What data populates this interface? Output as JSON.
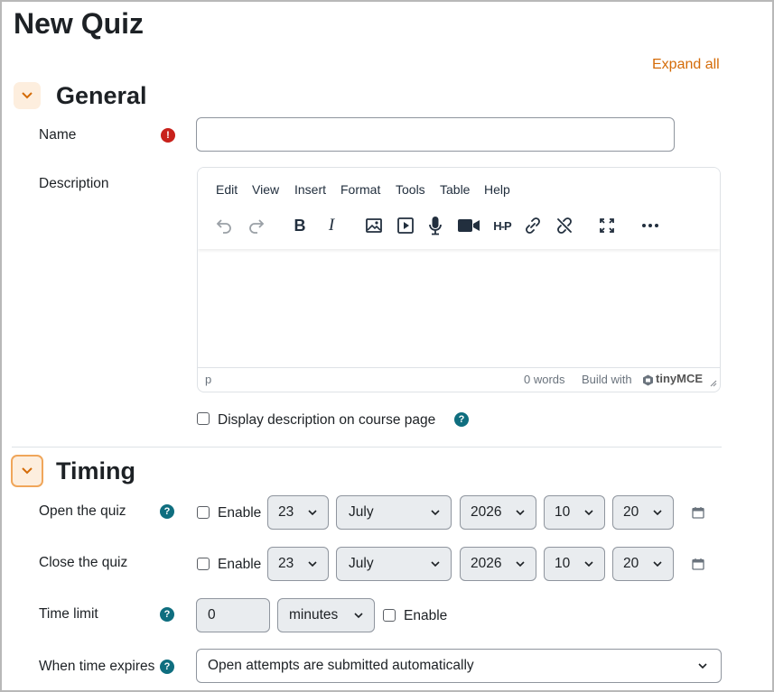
{
  "page": {
    "title": "New Quiz",
    "expand_all": "Expand all"
  },
  "general": {
    "title": "General",
    "name_label": "Name",
    "name_value": "",
    "description_label": "Description",
    "editor": {
      "menu": [
        "Edit",
        "View",
        "Insert",
        "Format",
        "Tools",
        "Table",
        "Help"
      ],
      "toolbar_icons": [
        "undo-icon",
        "redo-icon",
        "bold-icon",
        "italic-icon",
        "image-icon",
        "media-icon",
        "microphone-icon",
        "video-camera-icon",
        "h5p-icon",
        "link-icon",
        "unlink-icon",
        "fullscreen-icon",
        "more-icon"
      ],
      "bold": "B",
      "italic": "I",
      "h5p": "H-P",
      "status_path": "p",
      "word_count": "0 words",
      "build_with": "Build with",
      "brand": "tinyMCE"
    },
    "display_description_label": "Display description on course page"
  },
  "timing": {
    "title": "Timing",
    "open": {
      "label": "Open the quiz",
      "enable": "Enable",
      "day": "23",
      "month": "July",
      "year": "2026",
      "hour": "10",
      "minute": "20"
    },
    "close": {
      "label": "Close the quiz",
      "enable": "Enable",
      "day": "23",
      "month": "July",
      "year": "2026",
      "hour": "10",
      "minute": "20"
    },
    "time_limit": {
      "label": "Time limit",
      "value": "0",
      "unit": "minutes",
      "enable": "Enable"
    },
    "when_expires": {
      "label": "When time expires",
      "value": "Open attempts are submitted automatically"
    }
  },
  "icons": {
    "required": "!",
    "help": "?"
  },
  "colors": {
    "accent": "#d46b08",
    "help": "#0f6e7f",
    "required": "#c8211b",
    "section_toggle_bg": "#fdeede"
  }
}
